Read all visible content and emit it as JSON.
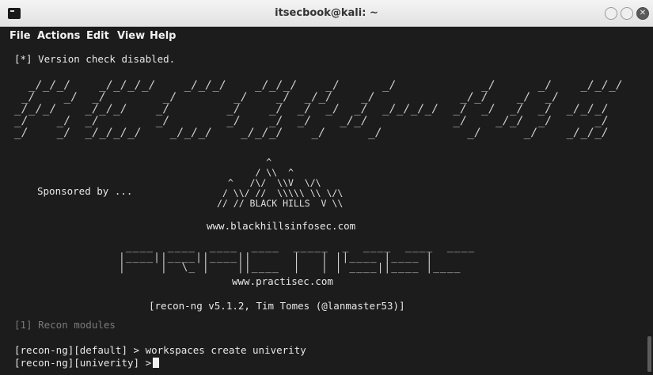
{
  "window": {
    "title": "itsecbook@kali: ~",
    "close_glyph": "✕"
  },
  "menu": {
    "items": [
      "File",
      "Actions",
      "Edit",
      "View",
      "Help"
    ]
  },
  "terminal": {
    "version_line": "[*] Version check disabled.",
    "recon_banner": [
      "  _/_/_/    _/_/_/_/    _/_/_/    _/_/_/    _/      _/            _/      _/    _/_/_/",
      " _/    _/  _/        _/        _/    _/  _/_/    _/            _/_/    _/  _/",
      "_/_/_/    _/_/_/    _/        _/    _/  _/  _/  _/  _/_/_/_/  _/  _/  _/  _/  _/_/_/",
      "_/    _/  _/        _/        _/    _/  _/    _/_/            _/    _/_/  _/      _/",
      "_/    _/  _/_/_/_/    _/_/_/    _/_/_/    _/      _/            _/      _/    _/_/_/"
    ],
    "sponsored_by": "Sponsored by ...",
    "bhis_logo_lines": [
      "         ^",
      "       / \\\\  ^",
      "  ^   /\\/  \\\\V  \\/\\",
      " / \\\\/ //  \\\\\\\\\\ \\\\ \\/\\",
      "// // BLACK HILLS  V \\\\"
    ],
    "bhis_url": "www.blackhillsinfosec.com",
    "practisec_logo_lines": [
      " ____  ____  ____  ____  _____  _  ____  ____  ____",
      "|____||____||____||      |   | ||____ |____ |",
      "|     |  \\_ |    ||____  |   | | ____||____ |____"
    ],
    "practisec_url": "www.practisec.com",
    "version_info": "[recon-ng v5.1.2, Tim Tomes (@lanmaster53)]",
    "module_count": "[1] Recon modules",
    "command_line": "[recon-ng][default] > workspaces create univerity",
    "prompt_line": "[recon-ng][univerity] >"
  }
}
